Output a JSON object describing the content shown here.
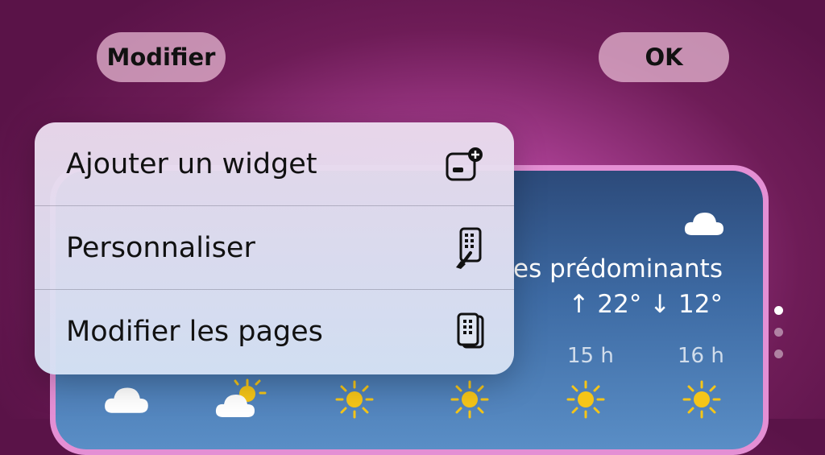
{
  "header": {
    "modifier_label": "Modifier",
    "ok_label": "OK"
  },
  "menu": {
    "items": [
      {
        "label": "Ajouter un widget",
        "icon": "add-widget-icon"
      },
      {
        "label": "Personnaliser",
        "icon": "customize-brush-icon"
      },
      {
        "label": "Modifier les pages",
        "icon": "edit-pages-icon"
      }
    ]
  },
  "weather_widget": {
    "condition": "es prédominants",
    "high_low": "↑ 22° ↓ 12°",
    "hours": [
      "15 h",
      "16 h"
    ],
    "hourly_icons": [
      "cloud-icon",
      "partly-sunny-icon",
      "sun-icon",
      "sun-icon",
      "sun-icon",
      "sun-icon"
    ]
  },
  "page_dots": {
    "count": 3,
    "active": 1
  }
}
